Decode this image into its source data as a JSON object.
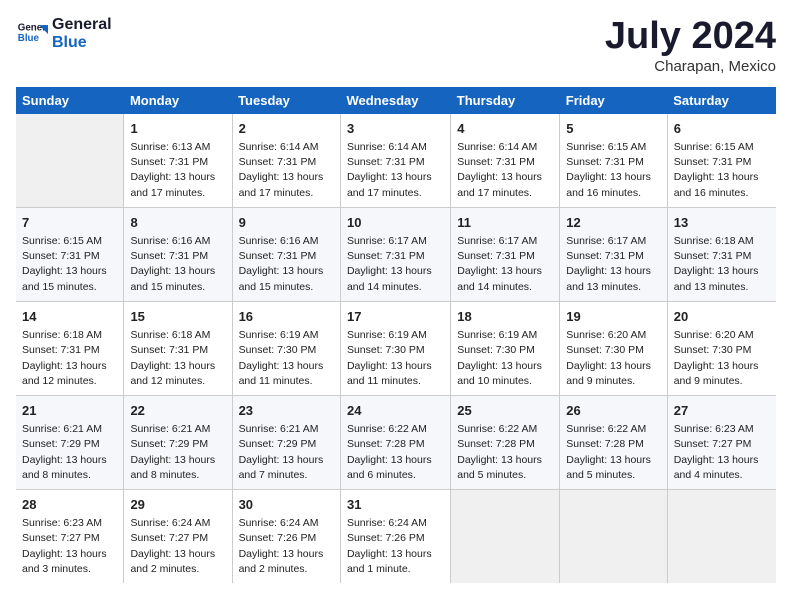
{
  "header": {
    "logo_line1": "General",
    "logo_line2": "Blue",
    "month": "July 2024",
    "location": "Charapan, Mexico"
  },
  "days_of_week": [
    "Sunday",
    "Monday",
    "Tuesday",
    "Wednesday",
    "Thursday",
    "Friday",
    "Saturday"
  ],
  "weeks": [
    [
      {
        "day": "",
        "info": ""
      },
      {
        "day": "1",
        "info": "Sunrise: 6:13 AM\nSunset: 7:31 PM\nDaylight: 13 hours\nand 17 minutes."
      },
      {
        "day": "2",
        "info": "Sunrise: 6:14 AM\nSunset: 7:31 PM\nDaylight: 13 hours\nand 17 minutes."
      },
      {
        "day": "3",
        "info": "Sunrise: 6:14 AM\nSunset: 7:31 PM\nDaylight: 13 hours\nand 17 minutes."
      },
      {
        "day": "4",
        "info": "Sunrise: 6:14 AM\nSunset: 7:31 PM\nDaylight: 13 hours\nand 17 minutes."
      },
      {
        "day": "5",
        "info": "Sunrise: 6:15 AM\nSunset: 7:31 PM\nDaylight: 13 hours\nand 16 minutes."
      },
      {
        "day": "6",
        "info": "Sunrise: 6:15 AM\nSunset: 7:31 PM\nDaylight: 13 hours\nand 16 minutes."
      }
    ],
    [
      {
        "day": "7",
        "info": "Sunrise: 6:15 AM\nSunset: 7:31 PM\nDaylight: 13 hours\nand 15 minutes."
      },
      {
        "day": "8",
        "info": "Sunrise: 6:16 AM\nSunset: 7:31 PM\nDaylight: 13 hours\nand 15 minutes."
      },
      {
        "day": "9",
        "info": "Sunrise: 6:16 AM\nSunset: 7:31 PM\nDaylight: 13 hours\nand 15 minutes."
      },
      {
        "day": "10",
        "info": "Sunrise: 6:17 AM\nSunset: 7:31 PM\nDaylight: 13 hours\nand 14 minutes."
      },
      {
        "day": "11",
        "info": "Sunrise: 6:17 AM\nSunset: 7:31 PM\nDaylight: 13 hours\nand 14 minutes."
      },
      {
        "day": "12",
        "info": "Sunrise: 6:17 AM\nSunset: 7:31 PM\nDaylight: 13 hours\nand 13 minutes."
      },
      {
        "day": "13",
        "info": "Sunrise: 6:18 AM\nSunset: 7:31 PM\nDaylight: 13 hours\nand 13 minutes."
      }
    ],
    [
      {
        "day": "14",
        "info": "Sunrise: 6:18 AM\nSunset: 7:31 PM\nDaylight: 13 hours\nand 12 minutes."
      },
      {
        "day": "15",
        "info": "Sunrise: 6:18 AM\nSunset: 7:31 PM\nDaylight: 13 hours\nand 12 minutes."
      },
      {
        "day": "16",
        "info": "Sunrise: 6:19 AM\nSunset: 7:30 PM\nDaylight: 13 hours\nand 11 minutes."
      },
      {
        "day": "17",
        "info": "Sunrise: 6:19 AM\nSunset: 7:30 PM\nDaylight: 13 hours\nand 11 minutes."
      },
      {
        "day": "18",
        "info": "Sunrise: 6:19 AM\nSunset: 7:30 PM\nDaylight: 13 hours\nand 10 minutes."
      },
      {
        "day": "19",
        "info": "Sunrise: 6:20 AM\nSunset: 7:30 PM\nDaylight: 13 hours\nand 9 minutes."
      },
      {
        "day": "20",
        "info": "Sunrise: 6:20 AM\nSunset: 7:30 PM\nDaylight: 13 hours\nand 9 minutes."
      }
    ],
    [
      {
        "day": "21",
        "info": "Sunrise: 6:21 AM\nSunset: 7:29 PM\nDaylight: 13 hours\nand 8 minutes."
      },
      {
        "day": "22",
        "info": "Sunrise: 6:21 AM\nSunset: 7:29 PM\nDaylight: 13 hours\nand 8 minutes."
      },
      {
        "day": "23",
        "info": "Sunrise: 6:21 AM\nSunset: 7:29 PM\nDaylight: 13 hours\nand 7 minutes."
      },
      {
        "day": "24",
        "info": "Sunrise: 6:22 AM\nSunset: 7:28 PM\nDaylight: 13 hours\nand 6 minutes."
      },
      {
        "day": "25",
        "info": "Sunrise: 6:22 AM\nSunset: 7:28 PM\nDaylight: 13 hours\nand 5 minutes."
      },
      {
        "day": "26",
        "info": "Sunrise: 6:22 AM\nSunset: 7:28 PM\nDaylight: 13 hours\nand 5 minutes."
      },
      {
        "day": "27",
        "info": "Sunrise: 6:23 AM\nSunset: 7:27 PM\nDaylight: 13 hours\nand 4 minutes."
      }
    ],
    [
      {
        "day": "28",
        "info": "Sunrise: 6:23 AM\nSunset: 7:27 PM\nDaylight: 13 hours\nand 3 minutes."
      },
      {
        "day": "29",
        "info": "Sunrise: 6:24 AM\nSunset: 7:27 PM\nDaylight: 13 hours\nand 2 minutes."
      },
      {
        "day": "30",
        "info": "Sunrise: 6:24 AM\nSunset: 7:26 PM\nDaylight: 13 hours\nand 2 minutes."
      },
      {
        "day": "31",
        "info": "Sunrise: 6:24 AM\nSunset: 7:26 PM\nDaylight: 13 hours\nand 1 minute."
      },
      {
        "day": "",
        "info": ""
      },
      {
        "day": "",
        "info": ""
      },
      {
        "day": "",
        "info": ""
      }
    ]
  ]
}
